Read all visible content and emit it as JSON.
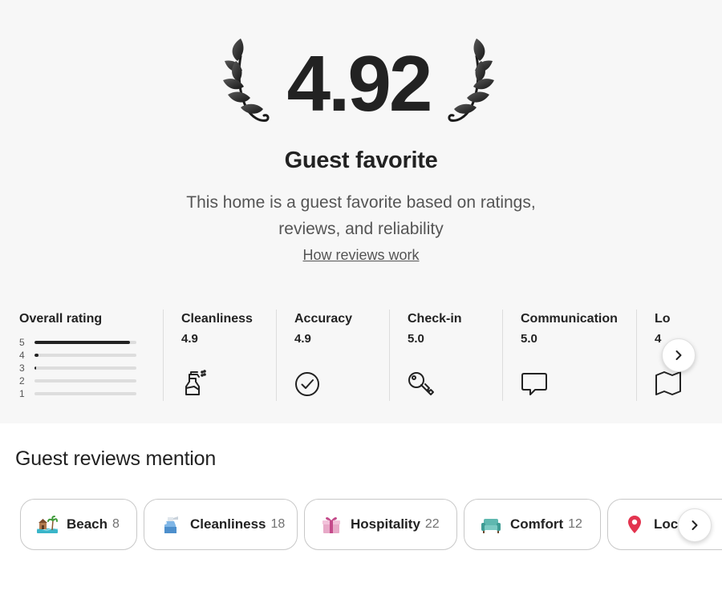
{
  "rating": {
    "value": "4.92",
    "title": "Guest favorite",
    "description": "This home is a guest favorite based on ratings, reviews, and reliability",
    "link": "How reviews work"
  },
  "overall": {
    "label": "Overall rating",
    "bars": [
      {
        "star": "5",
        "fraction": 0.94
      },
      {
        "star": "4",
        "fraction": 0.04
      },
      {
        "star": "3",
        "fraction": 0.015
      },
      {
        "star": "2",
        "fraction": 0
      },
      {
        "star": "1",
        "fraction": 0
      }
    ]
  },
  "categories": [
    {
      "label": "Cleanliness",
      "value": "4.9",
      "icon": "spray-bottle-icon"
    },
    {
      "label": "Accuracy",
      "value": "4.9",
      "icon": "check-circle-icon"
    },
    {
      "label": "Check-in",
      "value": "5.0",
      "icon": "key-icon"
    },
    {
      "label": "Communication",
      "value": "5.0",
      "icon": "chat-bubble-icon"
    },
    {
      "label": "Lo",
      "value": "4",
      "icon": "map-icon"
    }
  ],
  "mentions": {
    "title": "Guest reviews mention",
    "chips": [
      {
        "label": "Beach",
        "count": "8",
        "icon": "beach-icon"
      },
      {
        "label": "Cleanliness",
        "count": "18",
        "icon": "cleaning-spray-icon"
      },
      {
        "label": "Hospitality",
        "count": "22",
        "icon": "gift-icon"
      },
      {
        "label": "Comfort",
        "count": "12",
        "icon": "sofa-icon"
      },
      {
        "label": "Loca",
        "count": "",
        "icon": "location-pin-icon"
      }
    ]
  },
  "colors": {
    "text": "#222222",
    "muted": "#717171",
    "divider": "#dddddd",
    "background_top": "#f7f7f7",
    "pin": "#e3344f"
  }
}
